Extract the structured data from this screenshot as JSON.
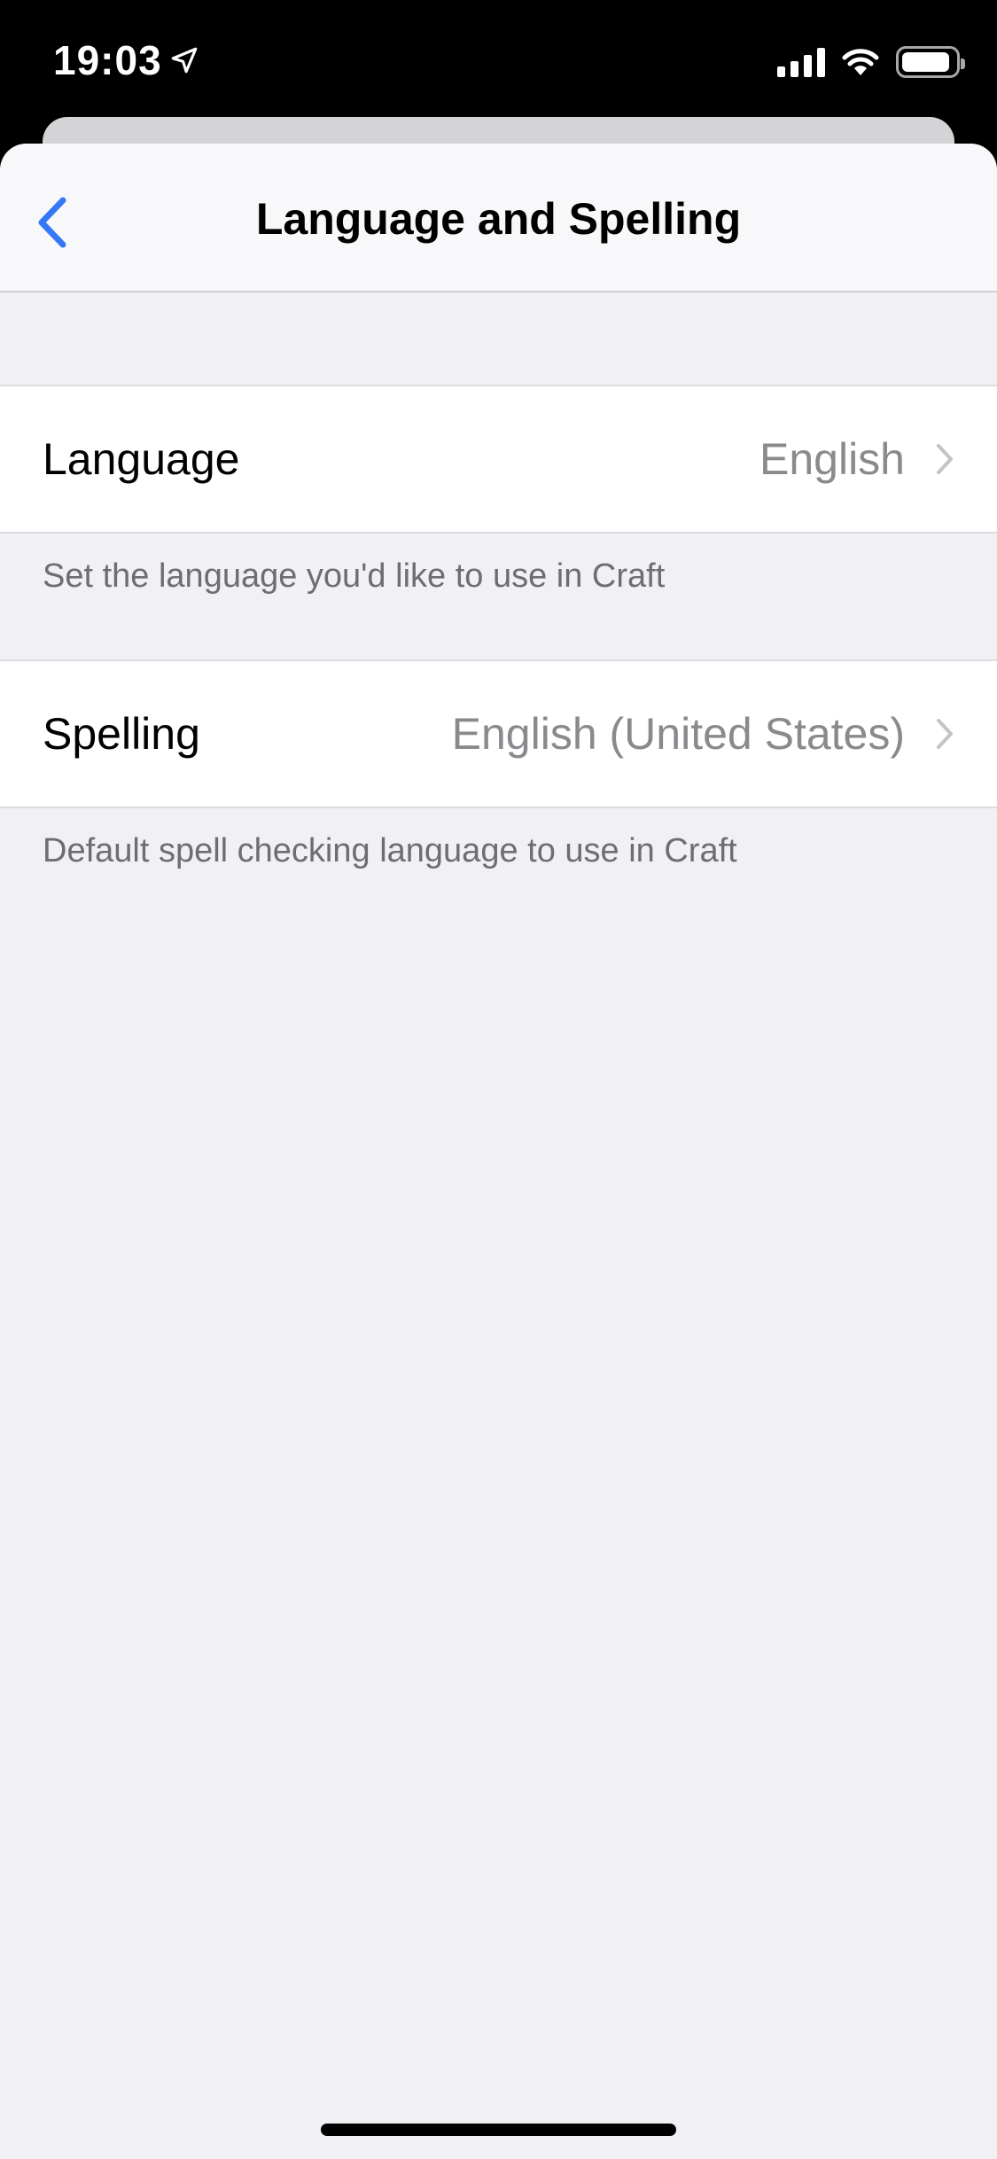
{
  "status_bar": {
    "time": "19:03",
    "location_icon": "location-arrow-icon",
    "signal_icon": "cellular-signal-icon",
    "wifi_icon": "wifi-icon",
    "battery_icon": "battery-icon"
  },
  "nav": {
    "title": "Language and Spelling",
    "back_icon": "chevron-left-icon"
  },
  "settings": [
    {
      "label": "Language",
      "value": "English",
      "footnote": "Set the language you'd like to use in Craft"
    },
    {
      "label": "Spelling",
      "value": "English (United States)",
      "footnote": "Default spell checking language to use in Craft"
    }
  ],
  "colors": {
    "accent": "#3478f6",
    "background": "#f0f0f5",
    "secondary_text": "#8a8a8e",
    "footnote_text": "#6d6d72"
  }
}
